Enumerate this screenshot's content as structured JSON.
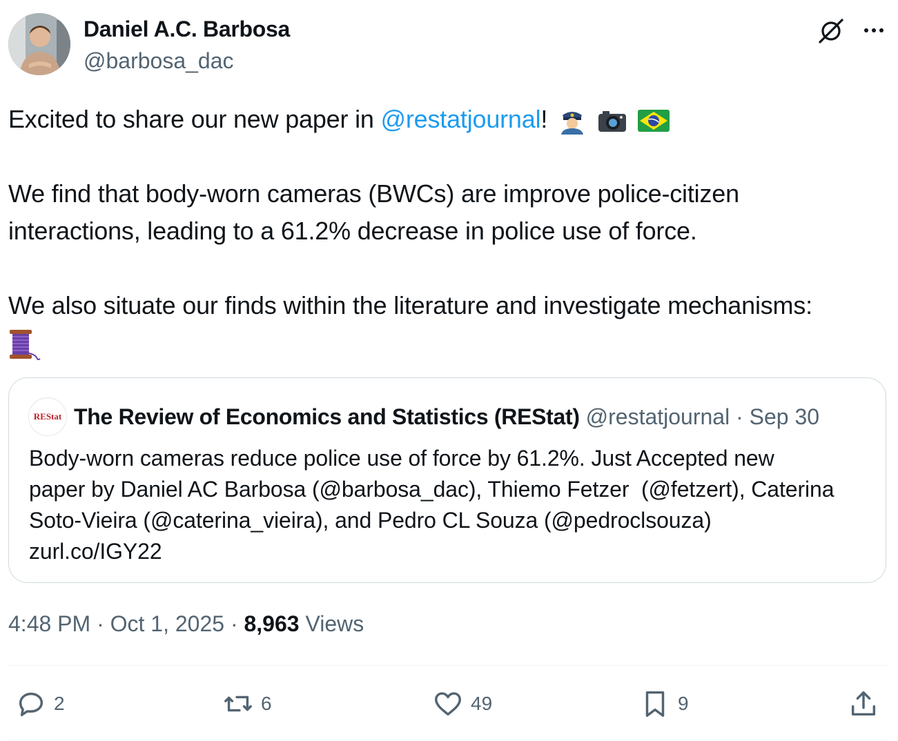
{
  "author": {
    "name": "Daniel A.C. Barbosa",
    "handle": "@barbosa_dac",
    "avatar_icon": "profile-photo"
  },
  "header_icons": [
    "grok-icon",
    "more-icon"
  ],
  "tweet": {
    "line1_prefix": "Excited to share our new paper in ",
    "line1_mention": "@restatjournal",
    "line1_suffix": "!",
    "line1_emojis": [
      "police-officer-emoji",
      "camera-emoji",
      "brazil-flag-emoji"
    ],
    "paragraph2": "We find that body-worn cameras (BWCs) are improve police-citizen interactions, leading to a 61.2% decrease in police use of force.",
    "paragraph3": "We also situate our finds within the literature and investigate mechanisms:",
    "paragraph3_emoji": "thread-spool-emoji"
  },
  "quote": {
    "avatar_text": "REStat",
    "author": "The Review of Economics and Statistics (REStat)",
    "handle": "@restatjournal",
    "separator": "·",
    "date": "Sep 30",
    "text_line1": "Body-worn cameras reduce police use of force by 61.2%. Just Accepted new",
    "text_line2": "paper by Daniel AC Barbosa (@barbosa_dac), Thiemo Fetzer  (@fetzert), Caterina",
    "text_line3": "Soto-Vieira (@caterina_vieira), and Pedro CL Souza (@pedroclsouza)",
    "text_line4": "zurl.co/IGY22"
  },
  "meta": {
    "time": "4:48 PM",
    "separator": "·",
    "date": "Oct 1, 2025",
    "views_count": "8,963",
    "views_label": "Views"
  },
  "actions": {
    "replies": "2",
    "reposts": "6",
    "likes": "49",
    "bookmarks": "9"
  },
  "colors": {
    "link": "#1d9bf0",
    "secondary_text": "#536471",
    "border": "#cfd9de"
  }
}
